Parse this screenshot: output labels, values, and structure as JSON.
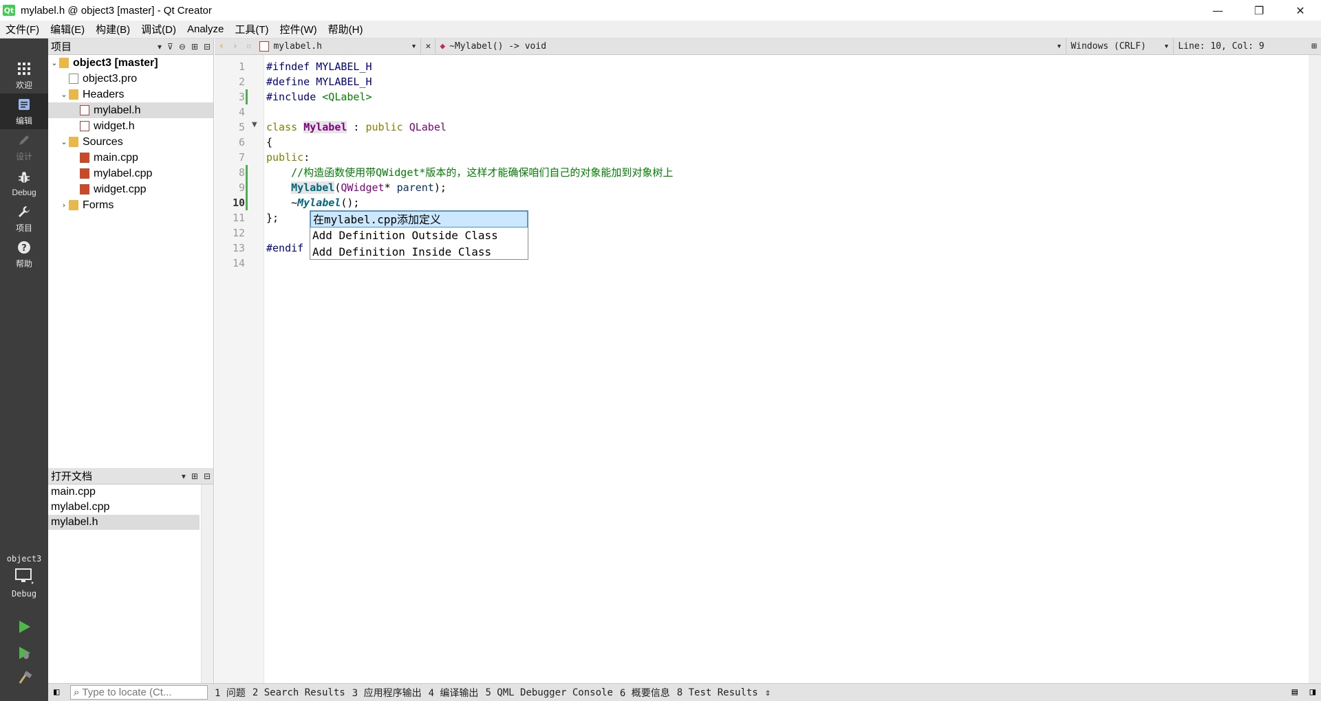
{
  "window": {
    "title": "mylabel.h @ object3 [master] - Qt Creator",
    "logo_text": "Qt",
    "minimize": "—",
    "restore": "❐",
    "close": "✕"
  },
  "menu": [
    "文件(F)",
    "编辑(E)",
    "构建(B)",
    "调试(D)",
    "Analyze",
    "工具(T)",
    "控件(W)",
    "帮助(H)"
  ],
  "modes": [
    {
      "label": "欢迎",
      "icon": "grid-icon"
    },
    {
      "label": "编辑",
      "icon": "edit-icon"
    },
    {
      "label": "设计",
      "icon": "design-icon"
    },
    {
      "label": "Debug",
      "icon": "bug-icon"
    },
    {
      "label": "项目",
      "icon": "wrench-icon"
    },
    {
      "label": "帮助",
      "icon": "help-icon"
    }
  ],
  "kit": {
    "project": "object3",
    "build": "Debug"
  },
  "projects_panel": {
    "title": "项目",
    "tree": [
      {
        "label": "object3 [master]",
        "level": 0,
        "kind": "proj-root",
        "expanded": true
      },
      {
        "label": "object3.pro",
        "level": 1,
        "kind": "proj"
      },
      {
        "label": "Headers",
        "level": 1,
        "kind": "folder",
        "expanded": true
      },
      {
        "label": "mylabel.h",
        "level": 2,
        "kind": "h",
        "selected": true
      },
      {
        "label": "widget.h",
        "level": 2,
        "kind": "h"
      },
      {
        "label": "Sources",
        "level": 1,
        "kind": "folder",
        "expanded": true
      },
      {
        "label": "main.cpp",
        "level": 2,
        "kind": "cpp"
      },
      {
        "label": "mylabel.cpp",
        "level": 2,
        "kind": "cpp"
      },
      {
        "label": "widget.cpp",
        "level": 2,
        "kind": "cpp"
      },
      {
        "label": "Forms",
        "level": 1,
        "kind": "folder",
        "expanded": false
      }
    ]
  },
  "open_docs": {
    "title": "打开文档",
    "items": [
      {
        "label": "main.cpp"
      },
      {
        "label": "mylabel.cpp"
      },
      {
        "label": "mylabel.h",
        "selected": true
      }
    ]
  },
  "editor_toolbar": {
    "file": "mylabel.h",
    "symbol": "~Mylabel() -> void",
    "encoding": "Windows (CRLF)",
    "position": "Line: 10, Col: 9"
  },
  "editor": {
    "line_numbers": [
      "1",
      "2",
      "3",
      "4",
      "5",
      "6",
      "7",
      "8",
      "9",
      "10",
      "11",
      "12",
      "13",
      "14"
    ],
    "current_line": "10"
  },
  "popup": {
    "items": [
      "在mylabel.cpp添加定义",
      "Add Definition Outside Class",
      "Add Definition Inside Class"
    ]
  },
  "statusbar": {
    "locator_placeholder": "Type to locate (Ct...",
    "panes": [
      "1 问题",
      "2 Search Results",
      "3 应用程序输出",
      "4 编译输出",
      "5 QML Debugger Console",
      "6 概要信息",
      "8 Test Results"
    ]
  }
}
